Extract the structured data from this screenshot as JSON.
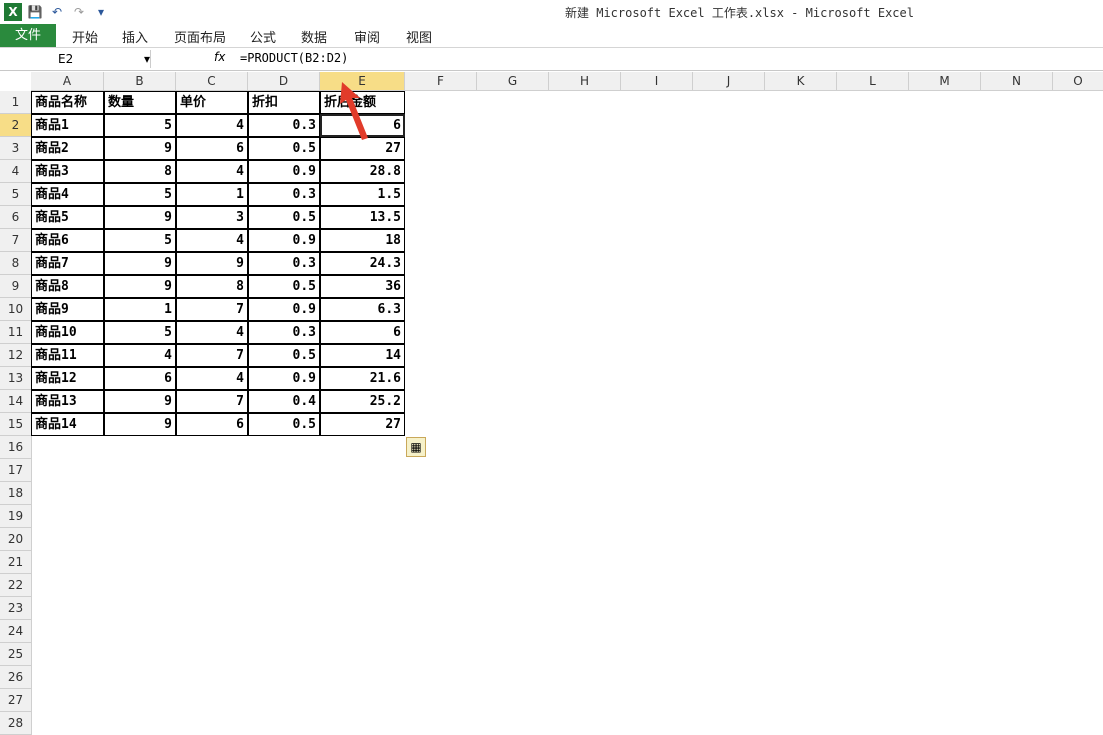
{
  "window": {
    "title": "新建 Microsoft Excel 工作表.xlsx - Microsoft Excel"
  },
  "ribbon": {
    "tabs": [
      "文件",
      "开始",
      "插入",
      "页面布局",
      "公式",
      "数据",
      "审阅",
      "视图"
    ]
  },
  "formula_bar": {
    "name_box": "E2",
    "fx": "fx",
    "formula": "=PRODUCT(B2:D2)"
  },
  "columns": [
    "A",
    "B",
    "C",
    "D",
    "E",
    "F",
    "G",
    "H",
    "I",
    "J",
    "K",
    "L",
    "M",
    "N",
    "O"
  ],
  "rows": [
    "1",
    "2",
    "3",
    "4",
    "5",
    "6",
    "7",
    "8",
    "9",
    "10",
    "11",
    "12",
    "13",
    "14",
    "15",
    "16",
    "17",
    "18",
    "19",
    "20",
    "21",
    "22",
    "23",
    "24",
    "25",
    "26",
    "27",
    "28"
  ],
  "table": {
    "headers": [
      "商品名称",
      "数量",
      "单价",
      "折扣",
      "折后金额"
    ],
    "rows": [
      [
        "商品1",
        "5",
        "4",
        "0.3",
        "6"
      ],
      [
        "商品2",
        "9",
        "6",
        "0.5",
        "27"
      ],
      [
        "商品3",
        "8",
        "4",
        "0.9",
        "28.8"
      ],
      [
        "商品4",
        "5",
        "1",
        "0.3",
        "1.5"
      ],
      [
        "商品5",
        "9",
        "3",
        "0.5",
        "13.5"
      ],
      [
        "商品6",
        "5",
        "4",
        "0.9",
        "18"
      ],
      [
        "商品7",
        "9",
        "9",
        "0.3",
        "24.3"
      ],
      [
        "商品8",
        "9",
        "8",
        "0.5",
        "36"
      ],
      [
        "商品9",
        "1",
        "7",
        "0.9",
        "6.3"
      ],
      [
        "商品10",
        "5",
        "4",
        "0.3",
        "6"
      ],
      [
        "商品11",
        "4",
        "7",
        "0.5",
        "14"
      ],
      [
        "商品12",
        "6",
        "4",
        "0.9",
        "21.6"
      ],
      [
        "商品13",
        "9",
        "7",
        "0.4",
        "25.2"
      ],
      [
        "商品14",
        "9",
        "6",
        "0.5",
        "27"
      ]
    ]
  }
}
